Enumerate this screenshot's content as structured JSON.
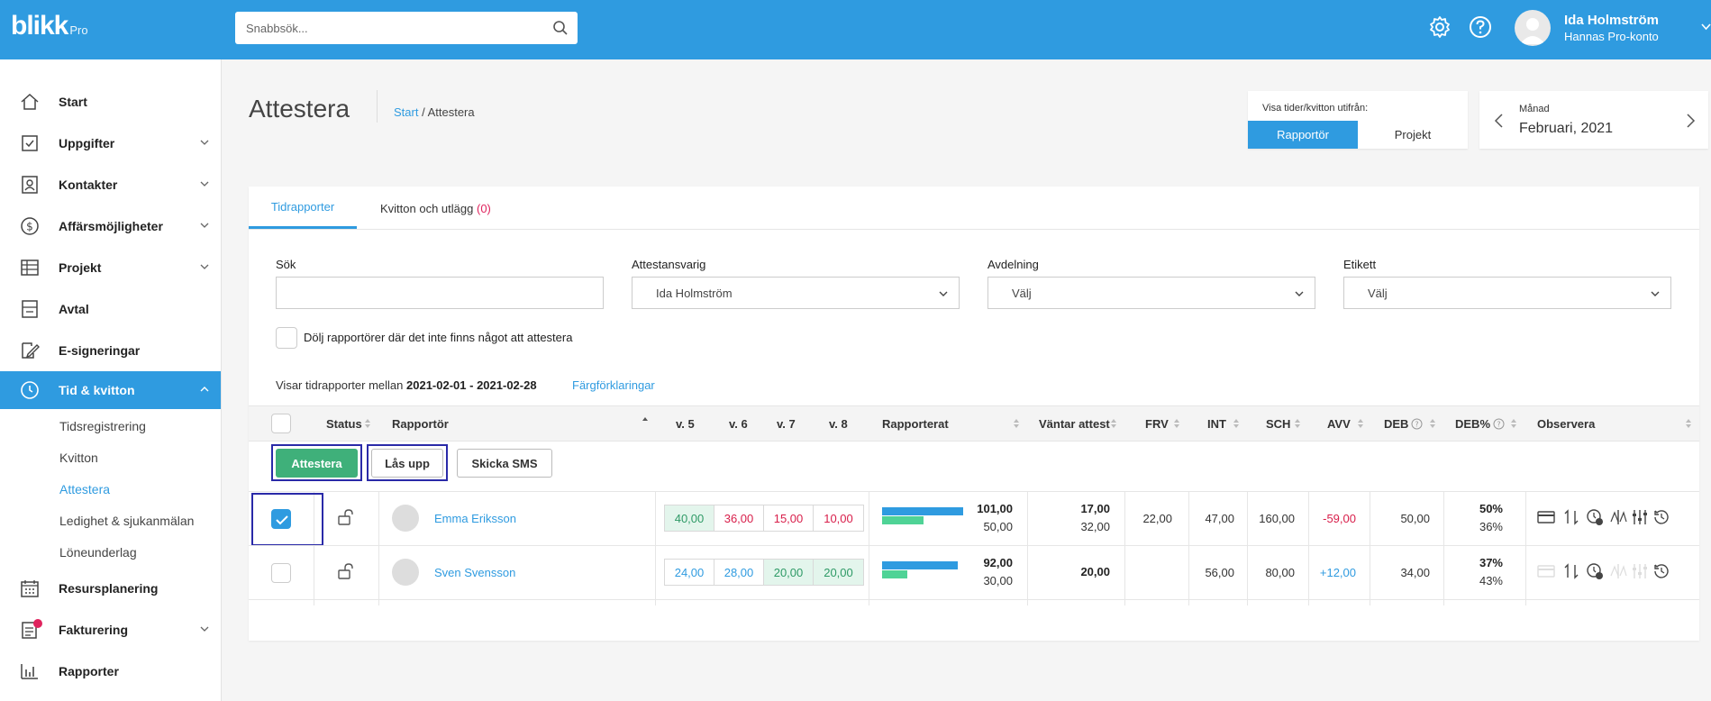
{
  "app": {
    "logo": "blikk",
    "logo_sub": "Pro",
    "search_placeholder": "Snabbsök...",
    "user_name": "Ida Holmström",
    "user_account": "Hannas Pro-konto"
  },
  "sidebar": {
    "items": [
      {
        "label": "Start",
        "icon": "home-icon"
      },
      {
        "label": "Uppgifter",
        "icon": "checkbox-icon"
      },
      {
        "label": "Kontakter",
        "icon": "contact-card-icon"
      },
      {
        "label": "Affärsmöjligheter",
        "icon": "dollar-circle-icon"
      },
      {
        "label": "Projekt",
        "icon": "table-icon"
      },
      {
        "label": "Avtal",
        "icon": "contract-icon"
      },
      {
        "label": "E-signeringar",
        "icon": "signature-icon"
      },
      {
        "label": "Tid & kvitton",
        "icon": "clock-icon"
      },
      {
        "label": "Resursplanering",
        "icon": "calendar-icon"
      },
      {
        "label": "Fakturering",
        "icon": "invoice-icon"
      },
      {
        "label": "Rapporter",
        "icon": "bar-chart-icon"
      }
    ],
    "sub_items": [
      "Tidsregistrering",
      "Kvitton",
      "Attestera",
      "Ledighet & sjukanmälan",
      "Löneunderlag"
    ]
  },
  "page": {
    "title": "Attestera",
    "breadcrumb_home": "Start",
    "breadcrumb_sep": " / ",
    "breadcrumb_current": "Attestera"
  },
  "view_toggle": {
    "label": "Visa tider/kvitton utifrån:",
    "option_a": "Rapportör",
    "option_b": "Projekt"
  },
  "period": {
    "label": "Månad",
    "value": "Februari, 2021"
  },
  "tabs": {
    "tab1": "Tidrapporter",
    "tab2": "Kvitton och utlägg",
    "tab2_count": "(0)"
  },
  "filters": {
    "search_label": "Sök",
    "search_value": "",
    "approver_label": "Attestansvarig",
    "approver_value": "Ida Holmström",
    "department_label": "Avdelning",
    "department_value": "Välj",
    "tag_label": "Etikett",
    "tag_value": "Välj",
    "hide_label": "Dölj rapportörer där det inte finns något att attestera"
  },
  "range": {
    "prefix": "Visar tidrapporter mellan",
    "value": "2021-02-01 - 2021-02-28",
    "legend_link": "Färgförklaringar"
  },
  "table": {
    "headers": {
      "status": "Status",
      "reporter": "Rapportör",
      "v5": "v. 5",
      "v6": "v. 6",
      "v7": "v. 7",
      "v8": "v. 8",
      "reported": "Rapporterat",
      "pending": "Väntar attest",
      "frv": "FRV",
      "int": "INT",
      "sch": "SCH",
      "avv": "AVV",
      "deb": "DEB",
      "debp": "DEB%",
      "observe": "Observera"
    },
    "actions": {
      "approve": "Attestera",
      "unlock": "Lås upp",
      "sms": "Skicka SMS"
    },
    "rows": [
      {
        "name": "Emma Eriksson",
        "checked": true,
        "weeks": [
          "40,00",
          "36,00",
          "15,00",
          "10,00"
        ],
        "reported_top": "101,00",
        "reported_bottom": "50,00",
        "pending_top": "17,00",
        "pending_bottom": "32,00",
        "frv": "22,00",
        "int": "47,00",
        "sch": "160,00",
        "avv": "-59,00",
        "deb": "50,00",
        "debp_top": "50%",
        "debp_bottom": "36%"
      },
      {
        "name": "Sven Svensson",
        "checked": false,
        "weeks": [
          "24,00",
          "28,00",
          "20,00",
          "20,00"
        ],
        "reported_top": "92,00",
        "reported_bottom": "30,00",
        "pending_top": "20,00",
        "pending_bottom": "",
        "frv": "",
        "int": "56,00",
        "sch": "80,00",
        "avv": "+12,00",
        "deb": "34,00",
        "debp_top": "37%",
        "debp_bottom": "43%"
      }
    ]
  },
  "colors": {
    "brand": "#2f9be0",
    "approve": "#3fb07a",
    "negative": "#d81e4a",
    "bar_blue": "#2f9be0",
    "bar_green": "#4fd396"
  }
}
